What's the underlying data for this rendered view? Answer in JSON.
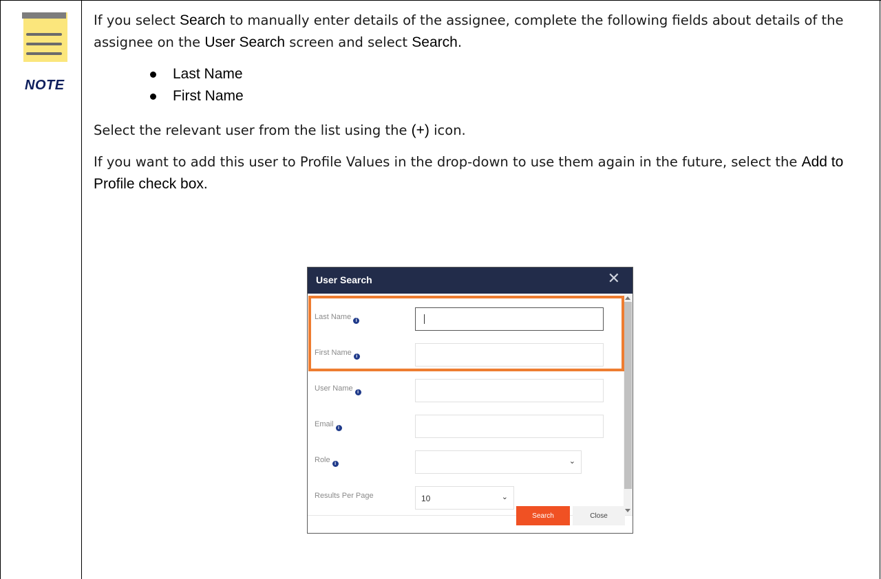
{
  "note": {
    "label": "NOTE"
  },
  "content": {
    "p1": [
      "If you select ",
      "Search",
      " to manually enter details of the assignee, complete the following fields about details of the assignee on the ",
      "User Search",
      " screen and select ",
      "Search",
      "."
    ],
    "bullets": [
      "Last Name",
      "First Name"
    ],
    "p2": [
      "Select the relevant user from the list using the ",
      "(+)",
      " icon."
    ],
    "p3": [
      "If you want to add this user to Profile Values in the drop-down to use them again in the future, select the ",
      "Add to Profile check box."
    ]
  },
  "dialog": {
    "title": "User Search",
    "close_glyph": "✕",
    "fields": {
      "last_name": {
        "label": "Last Name",
        "value": ""
      },
      "first_name": {
        "label": "First Name",
        "value": ""
      },
      "user_name": {
        "label": "User Name",
        "value": ""
      },
      "email": {
        "label": "Email",
        "value": ""
      },
      "role": {
        "label": "Role",
        "value": ""
      },
      "results_per_page": {
        "label": "Results Per Page",
        "value": "10"
      }
    },
    "info_glyph": "i",
    "chevron_glyph": "⌄",
    "search_label": "Search",
    "close_label": "Close"
  },
  "colors": {
    "note_pad": "#fbe67c",
    "note_text": "#0d1e5c",
    "dialog_header": "#222c4a",
    "highlight": "#ee7d31",
    "search_button": "#f05123"
  }
}
